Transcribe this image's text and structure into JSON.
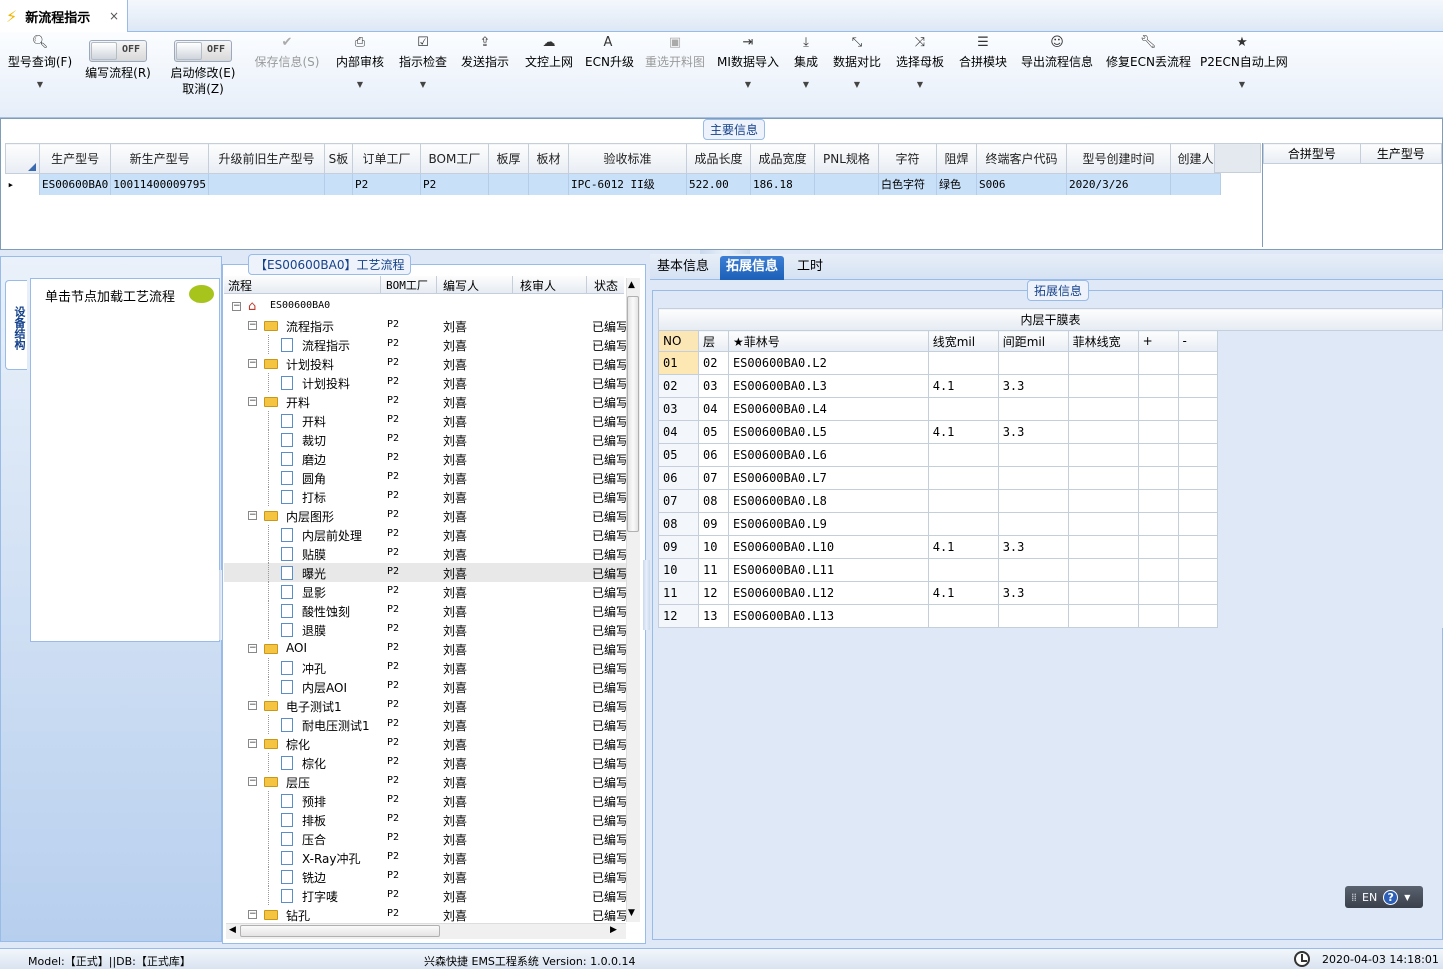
{
  "tab": {
    "title": "新流程指示",
    "close": "×"
  },
  "toolbar": {
    "query": {
      "label": "型号查询(F)"
    },
    "edit_flow": {
      "label": "编写流程(R)",
      "toggle": "OFF"
    },
    "enable_modify": {
      "label": "启动修改(E)",
      "sub": "取消(Z)",
      "toggle": "OFF"
    },
    "save_info": {
      "label": "保存信息(S)"
    },
    "internal_review": {
      "label": "内部审核"
    },
    "instruction_check": {
      "label": "指示检查"
    },
    "send_instruction": {
      "label": "发送指示"
    },
    "text_upload": {
      "label": "文控上网"
    },
    "ecn_upgrade": {
      "label": "ECN升级"
    },
    "reselect_cutting": {
      "label": "重选开料图"
    },
    "mi_import": {
      "label": "MI数据导入"
    },
    "integrate": {
      "label": "集成"
    },
    "data_compare": {
      "label": "数据对比"
    },
    "select_master": {
      "label": "选择母板"
    },
    "merge_module": {
      "label": "合拼模块"
    },
    "export_flow": {
      "label": "导出流程信息"
    },
    "repair_ecn": {
      "label": "修复ECN丢流程"
    },
    "p2ecn_auto": {
      "label": "P2ECN自动上网"
    }
  },
  "main_info": {
    "group_title": "主要信息",
    "columns": [
      "生产型号",
      "新生产型号",
      "升级前旧生产型号",
      "S板",
      "订单工厂",
      "BOM工厂",
      "板厚",
      "板材",
      "验收标准",
      "成品长度",
      "成品宽度",
      "PNL规格",
      "字符",
      "阻焊",
      "终端客户代码",
      "型号创建时间",
      "创建人"
    ],
    "row": [
      "ES00600BA0",
      "10011400009795",
      "",
      "",
      "P2",
      "P2",
      "",
      "",
      "IPC-6012 II级",
      "522.00",
      "186.18",
      "",
      "白色字符",
      "绿色",
      "S006",
      "2020/3/26",
      ""
    ],
    "merge_columns": [
      "合拼型号",
      "生产型号"
    ]
  },
  "left_panel": {
    "vertical_tab": "设备结构",
    "hint": "单击节点加载工艺流程"
  },
  "flow": {
    "group_title": "【ES00600BA0】工艺流程",
    "columns": [
      "流程",
      "BOM工厂",
      "编写人",
      "核审人",
      "状态"
    ],
    "rows": [
      {
        "name": "ES00600BA0",
        "level": 0,
        "type": "root",
        "factory": "",
        "writer": "",
        "reviewer": "",
        "status": ""
      },
      {
        "name": "流程指示",
        "level": 1,
        "type": "folder",
        "factory": "P2",
        "writer": "刘喜",
        "reviewer": "",
        "status": "已编写"
      },
      {
        "name": "流程指示",
        "level": 2,
        "type": "file",
        "factory": "P2",
        "writer": "刘喜",
        "reviewer": "",
        "status": "已编写"
      },
      {
        "name": "计划投料",
        "level": 1,
        "type": "folder",
        "factory": "P2",
        "writer": "刘喜",
        "reviewer": "",
        "status": "已编写"
      },
      {
        "name": "计划投料",
        "level": 2,
        "type": "file",
        "factory": "P2",
        "writer": "刘喜",
        "reviewer": "",
        "status": "已编写"
      },
      {
        "name": "开料",
        "level": 1,
        "type": "folder",
        "factory": "P2",
        "writer": "刘喜",
        "reviewer": "",
        "status": "已编写"
      },
      {
        "name": "开料",
        "level": 2,
        "type": "file",
        "factory": "P2",
        "writer": "刘喜",
        "reviewer": "",
        "status": "已编写"
      },
      {
        "name": "裁切",
        "level": 2,
        "type": "file",
        "factory": "P2",
        "writer": "刘喜",
        "reviewer": "",
        "status": "已编写"
      },
      {
        "name": "磨边",
        "level": 2,
        "type": "file",
        "factory": "P2",
        "writer": "刘喜",
        "reviewer": "",
        "status": "已编写"
      },
      {
        "name": "圆角",
        "level": 2,
        "type": "file",
        "factory": "P2",
        "writer": "刘喜",
        "reviewer": "",
        "status": "已编写"
      },
      {
        "name": "打标",
        "level": 2,
        "type": "file",
        "factory": "P2",
        "writer": "刘喜",
        "reviewer": "",
        "status": "已编写"
      },
      {
        "name": "内层图形",
        "level": 1,
        "type": "folder",
        "factory": "P2",
        "writer": "刘喜",
        "reviewer": "",
        "status": "已编写"
      },
      {
        "name": "内层前处理",
        "level": 2,
        "type": "file",
        "factory": "P2",
        "writer": "刘喜",
        "reviewer": "",
        "status": "已编写"
      },
      {
        "name": "贴膜",
        "level": 2,
        "type": "file",
        "factory": "P2",
        "writer": "刘喜",
        "reviewer": "",
        "status": "已编写"
      },
      {
        "name": "曝光",
        "level": 2,
        "type": "file",
        "factory": "P2",
        "writer": "刘喜",
        "reviewer": "",
        "status": "已编写",
        "selected": true
      },
      {
        "name": "显影",
        "level": 2,
        "type": "file",
        "factory": "P2",
        "writer": "刘喜",
        "reviewer": "",
        "status": "已编写"
      },
      {
        "name": "酸性蚀刻",
        "level": 2,
        "type": "file",
        "factory": "P2",
        "writer": "刘喜",
        "reviewer": "",
        "status": "已编写"
      },
      {
        "name": "退膜",
        "level": 2,
        "type": "file",
        "factory": "P2",
        "writer": "刘喜",
        "reviewer": "",
        "status": "已编写"
      },
      {
        "name": "AOI",
        "level": 1,
        "type": "folder",
        "factory": "P2",
        "writer": "刘喜",
        "reviewer": "",
        "status": "已编写"
      },
      {
        "name": "冲孔",
        "level": 2,
        "type": "file",
        "factory": "P2",
        "writer": "刘喜",
        "reviewer": "",
        "status": "已编写"
      },
      {
        "name": "内层AOI",
        "level": 2,
        "type": "file",
        "factory": "P2",
        "writer": "刘喜",
        "reviewer": "",
        "status": "已编写"
      },
      {
        "name": "电子测试1",
        "level": 1,
        "type": "folder",
        "factory": "P2",
        "writer": "刘喜",
        "reviewer": "",
        "status": "已编写"
      },
      {
        "name": "耐电压测试1",
        "level": 2,
        "type": "file",
        "factory": "P2",
        "writer": "刘喜",
        "reviewer": "",
        "status": "已编写"
      },
      {
        "name": "棕化",
        "level": 1,
        "type": "folder",
        "factory": "P2",
        "writer": "刘喜",
        "reviewer": "",
        "status": "已编写"
      },
      {
        "name": "棕化",
        "level": 2,
        "type": "file",
        "factory": "P2",
        "writer": "刘喜",
        "reviewer": "",
        "status": "已编写"
      },
      {
        "name": "层压",
        "level": 1,
        "type": "folder",
        "factory": "P2",
        "writer": "刘喜",
        "reviewer": "",
        "status": "已编写"
      },
      {
        "name": "预排",
        "level": 2,
        "type": "file",
        "factory": "P2",
        "writer": "刘喜",
        "reviewer": "",
        "status": "已编写"
      },
      {
        "name": "排板",
        "level": 2,
        "type": "file",
        "factory": "P2",
        "writer": "刘喜",
        "reviewer": "",
        "status": "已编写"
      },
      {
        "name": "压合",
        "level": 2,
        "type": "file",
        "factory": "P2",
        "writer": "刘喜",
        "reviewer": "",
        "status": "已编写"
      },
      {
        "name": "X-Ray冲孔",
        "level": 2,
        "type": "file",
        "factory": "P2",
        "writer": "刘喜",
        "reviewer": "",
        "status": "已编写"
      },
      {
        "name": "铣边",
        "level": 2,
        "type": "file",
        "factory": "P2",
        "writer": "刘喜",
        "reviewer": "",
        "status": "已编写"
      },
      {
        "name": "打字唛",
        "level": 2,
        "type": "file",
        "factory": "P2",
        "writer": "刘喜",
        "reviewer": "",
        "status": "已编写"
      },
      {
        "name": "钻孔",
        "level": 1,
        "type": "folder",
        "factory": "P2",
        "writer": "刘喜",
        "reviewer": "",
        "status": "已编写"
      }
    ]
  },
  "right_tabs": [
    "基本信息",
    "拓展信息",
    "工时"
  ],
  "extended": {
    "group_title": "拓展信息",
    "table_title": "内层干膜表",
    "columns": [
      "NO",
      "层",
      "★菲林号",
      "线宽mil",
      "间距mil",
      "菲林线宽",
      "+",
      "-"
    ],
    "rows": [
      [
        "01",
        "02",
        "ES00600BA0.L2",
        "",
        "",
        "",
        "",
        ""
      ],
      [
        "02",
        "03",
        "ES00600BA0.L3",
        "4.1",
        "3.3",
        "",
        "",
        ""
      ],
      [
        "03",
        "04",
        "ES00600BA0.L4",
        "",
        "",
        "",
        "",
        ""
      ],
      [
        "04",
        "05",
        "ES00600BA0.L5",
        "4.1",
        "3.3",
        "",
        "",
        ""
      ],
      [
        "05",
        "06",
        "ES00600BA0.L6",
        "",
        "",
        "",
        "",
        ""
      ],
      [
        "06",
        "07",
        "ES00600BA0.L7",
        "",
        "",
        "",
        "",
        ""
      ],
      [
        "07",
        "08",
        "ES00600BA0.L8",
        "",
        "",
        "",
        "",
        ""
      ],
      [
        "08",
        "09",
        "ES00600BA0.L9",
        "",
        "",
        "",
        "",
        ""
      ],
      [
        "09",
        "10",
        "ES00600BA0.L10",
        "4.1",
        "3.3",
        "",
        "",
        ""
      ],
      [
        "10",
        "11",
        "ES00600BA0.L11",
        "",
        "",
        "",
        "",
        ""
      ],
      [
        "11",
        "12",
        "ES00600BA0.L12",
        "4.1",
        "3.3",
        "",
        "",
        ""
      ],
      [
        "12",
        "13",
        "ES00600BA0.L13",
        "",
        "",
        "",
        "",
        ""
      ]
    ]
  },
  "language": {
    "code": "EN",
    "help": "?"
  },
  "status": {
    "model": "Model:【正式】||DB:【正式库】",
    "system": "兴森快捷 EMS工程系统 Version: 1.0.0.14",
    "time": "2020-04-03 14:18:01"
  }
}
